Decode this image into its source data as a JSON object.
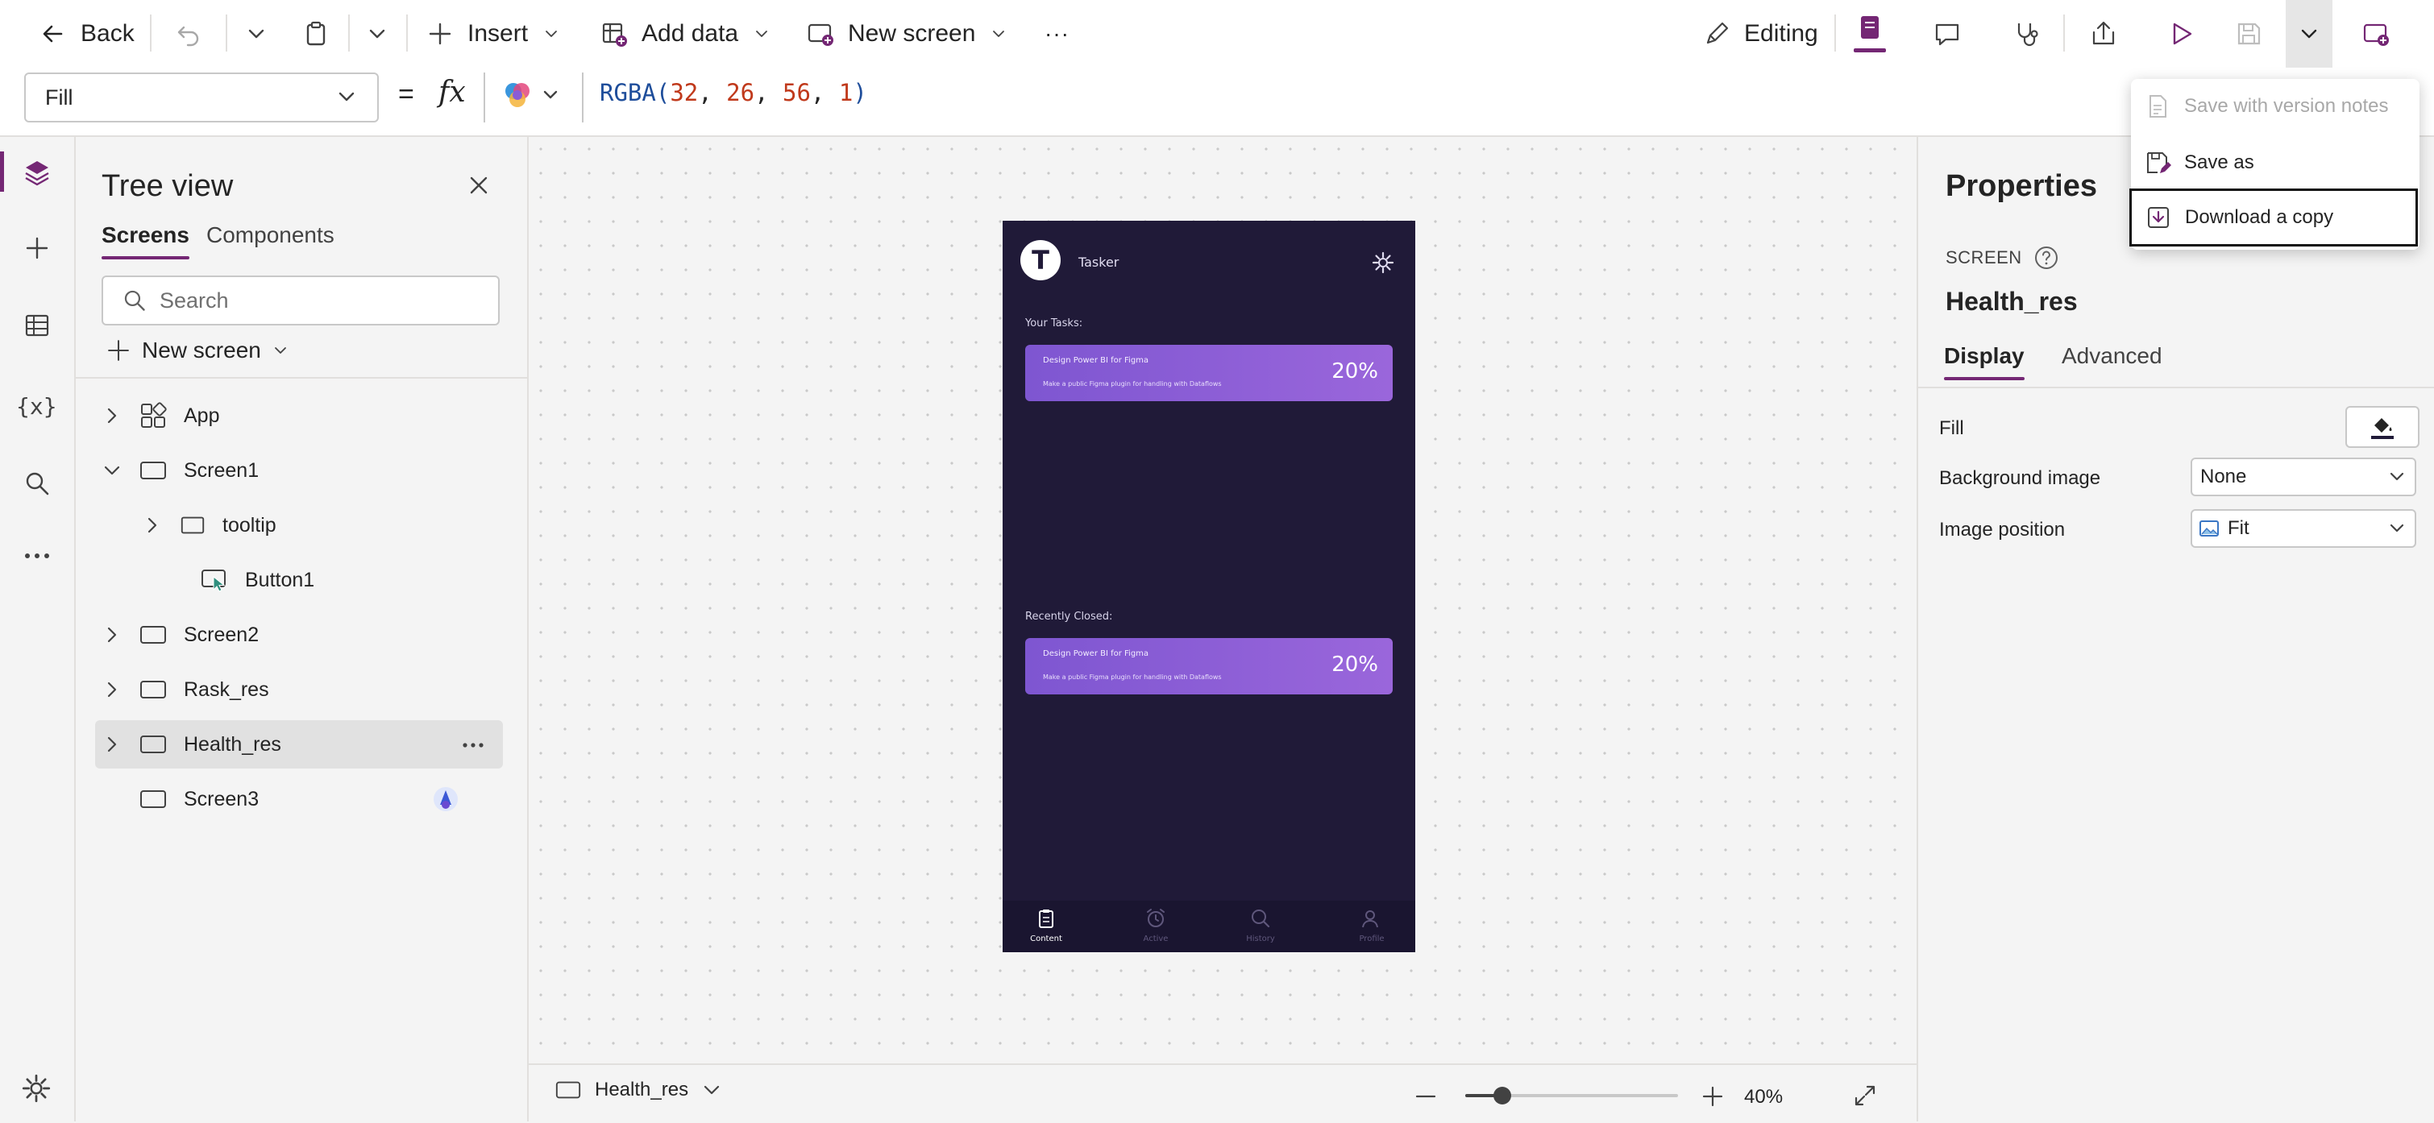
{
  "command_bar": {
    "back_label": "Back",
    "insert_label": "Insert",
    "add_data_label": "Add data",
    "new_screen_label": "New screen",
    "more_label": "···",
    "editing_label": "Editing"
  },
  "formula_bar": {
    "property": "Fill",
    "equals": "=",
    "fx": "fx",
    "formula": {
      "func": "RGBA(",
      "args": [
        "32",
        "26",
        "56",
        "1"
      ],
      "sep": ", ",
      "close": ")"
    }
  },
  "tree_view": {
    "title": "Tree view",
    "tabs": [
      "Screens",
      "Components"
    ],
    "active_tab": "Screens",
    "search_placeholder": "Search",
    "new_screen_label": "New screen",
    "nodes": [
      {
        "label": "App",
        "level": 0,
        "expander": "collapsed",
        "icon": "app-icon"
      },
      {
        "label": "Screen1",
        "level": 0,
        "expander": "expanded",
        "icon": "screen-icon"
      },
      {
        "label": "tooltip",
        "level": 1,
        "expander": "collapsed",
        "icon": "container-icon"
      },
      {
        "label": "Button1",
        "level": 1,
        "expander": "none",
        "icon": "button-icon"
      },
      {
        "label": "Screen2",
        "level": 0,
        "expander": "collapsed",
        "icon": "screen-icon"
      },
      {
        "label": "Rask_res",
        "level": 0,
        "expander": "collapsed",
        "icon": "screen-icon"
      },
      {
        "label": "Health_res",
        "level": 0,
        "expander": "collapsed",
        "icon": "screen-icon",
        "selected": true
      },
      {
        "label": "Screen3",
        "level": 0,
        "expander": "none",
        "icon": "screen-icon",
        "badge": "copilot-agent-icon"
      }
    ]
  },
  "phone": {
    "logo_letter": "T",
    "app_name": "Tasker",
    "your_tasks_label": "Your Tasks:",
    "recently_closed_label": "Recently Closed:",
    "task_cards": [
      {
        "title": "Design Power BI for Figma",
        "subtitle": "Make a public Figma plugin for handling with Dataflows",
        "percent": "20%"
      },
      {
        "title": "Design Power BI for Figma",
        "subtitle": "Make a public Figma plugin for handling with Dataflows",
        "percent": "20%"
      }
    ],
    "nav": [
      "Content",
      "Active",
      "History",
      "Profile"
    ],
    "background_color": "#201a38",
    "card_color": "#8a5cd6"
  },
  "status_bar": {
    "screen_name": "Health_res",
    "zoom": "40%",
    "zoom_level": 0.4
  },
  "properties": {
    "title": "Properties",
    "type_label": "SCREEN",
    "screen_name": "Health_res",
    "tabs": [
      "Display",
      "Advanced"
    ],
    "active_tab": "Display",
    "fill_label": "Fill",
    "background_image_label": "Background image",
    "background_image_value": "None",
    "image_position_label": "Image position",
    "image_position_value": "Fit"
  },
  "save_menu": {
    "items": [
      {
        "label": "Save with version notes",
        "disabled": true
      },
      {
        "label": "Save as",
        "disabled": false
      },
      {
        "label": "Download a copy",
        "disabled": false,
        "focused": true
      }
    ]
  },
  "colors": {
    "accent": "#742774",
    "formula_number": "#c0391b",
    "formula_func": "#1f4e9b",
    "phone_bg": "#201a38"
  }
}
